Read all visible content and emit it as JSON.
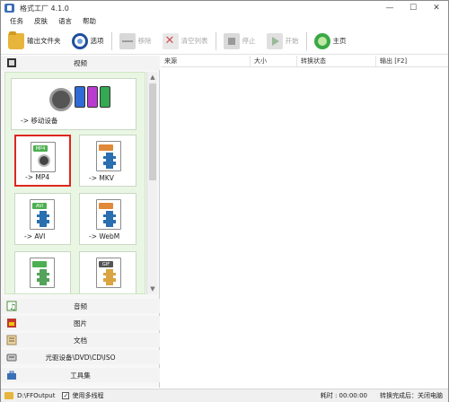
{
  "window": {
    "title": "格式工厂 4.1.0",
    "minimize": "—",
    "maximize": "☐",
    "close": "✕"
  },
  "menu": [
    "任务",
    "皮肤",
    "语言",
    "帮助"
  ],
  "toolbar": {
    "output_folder": "输出文件夹",
    "options": "选项",
    "remove": "移除",
    "clear_list": "清空列表",
    "stop": "停止",
    "start": "开始",
    "home": "主页"
  },
  "categories": {
    "video": "视频",
    "audio": "音频",
    "picture": "图片",
    "document": "文档",
    "rom": "光驱设备\\DVD\\CD\\ISO",
    "tools": "工具集"
  },
  "video_tiles": {
    "mobile": "-> 移动设备",
    "mp4": "-> MP4",
    "mkv": "-> MKV",
    "avi": "-> AVI",
    "webm": "-> WebM",
    "mp4_tag": "MP4",
    "avi_tag": "AVI",
    "gif_tag": "GIF"
  },
  "table": {
    "columns": [
      "来源",
      "大小",
      "转换状态",
      "输出 [F2]"
    ]
  },
  "status": {
    "output_path": "D:\\FFOutput",
    "multithread": "使用多线程",
    "elapsed": "耗时 : 00:00:00",
    "after_convert": "转换完成后：关闭电脑"
  },
  "colors": {
    "selected_border": "#e0251f",
    "video_area_bg": "#e9f6e3"
  }
}
